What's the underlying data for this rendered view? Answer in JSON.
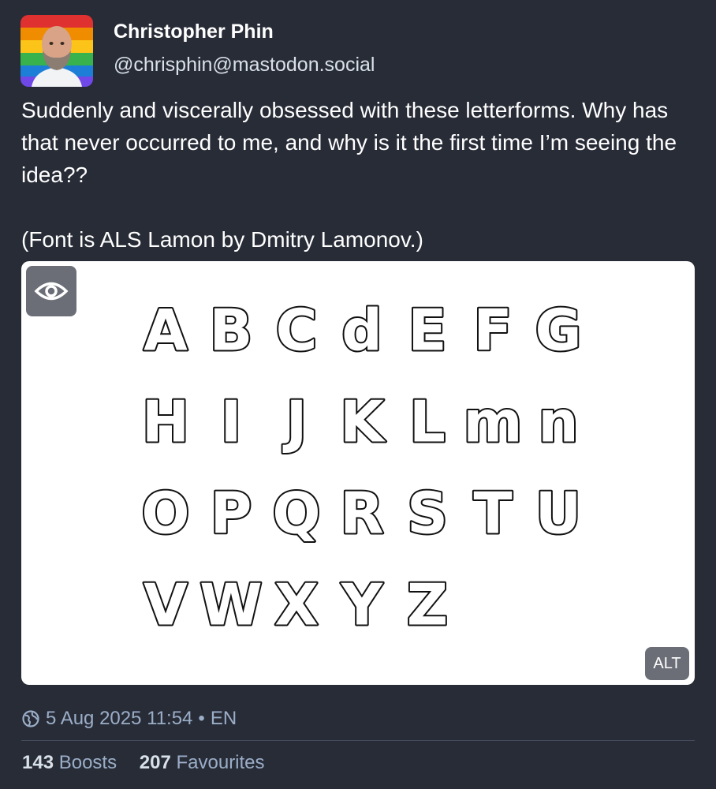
{
  "author": {
    "display_name": "Christopher Phin",
    "handle": "@chrisphin@mastodon.social",
    "avatar_icon": "avatar-photo"
  },
  "post": {
    "paragraphs": [
      "Suddenly and viscerally obsessed with these letterforms. Why has that never occurred to me, and why is it the first time I’m seeing the idea??",
      "(Font is ALS Lamon by Dmitry Lamonov.)"
    ]
  },
  "media": {
    "letters": [
      "A",
      "B",
      "C",
      "d",
      "E",
      "F",
      "G",
      "H",
      "I",
      "J",
      "K",
      "L",
      "m",
      "n",
      "O",
      "P",
      "Q",
      "R",
      "S",
      "T",
      "U",
      "V",
      "W",
      "X",
      "Y",
      "Z"
    ],
    "alt_label": "ALT",
    "hide_icon": "eye-icon",
    "background": "#ffffff"
  },
  "meta": {
    "visibility_icon": "globe-icon",
    "timestamp": "5 Aug 2025 11:54",
    "separator": "•",
    "language": "EN"
  },
  "stats": {
    "boosts_count": "143",
    "boosts_label": "Boosts",
    "favourites_count": "207",
    "favourites_label": "Favourites"
  },
  "colors": {
    "background": "#282c37",
    "secondary_text": "#9baec8",
    "badge": "#6b6e76"
  }
}
